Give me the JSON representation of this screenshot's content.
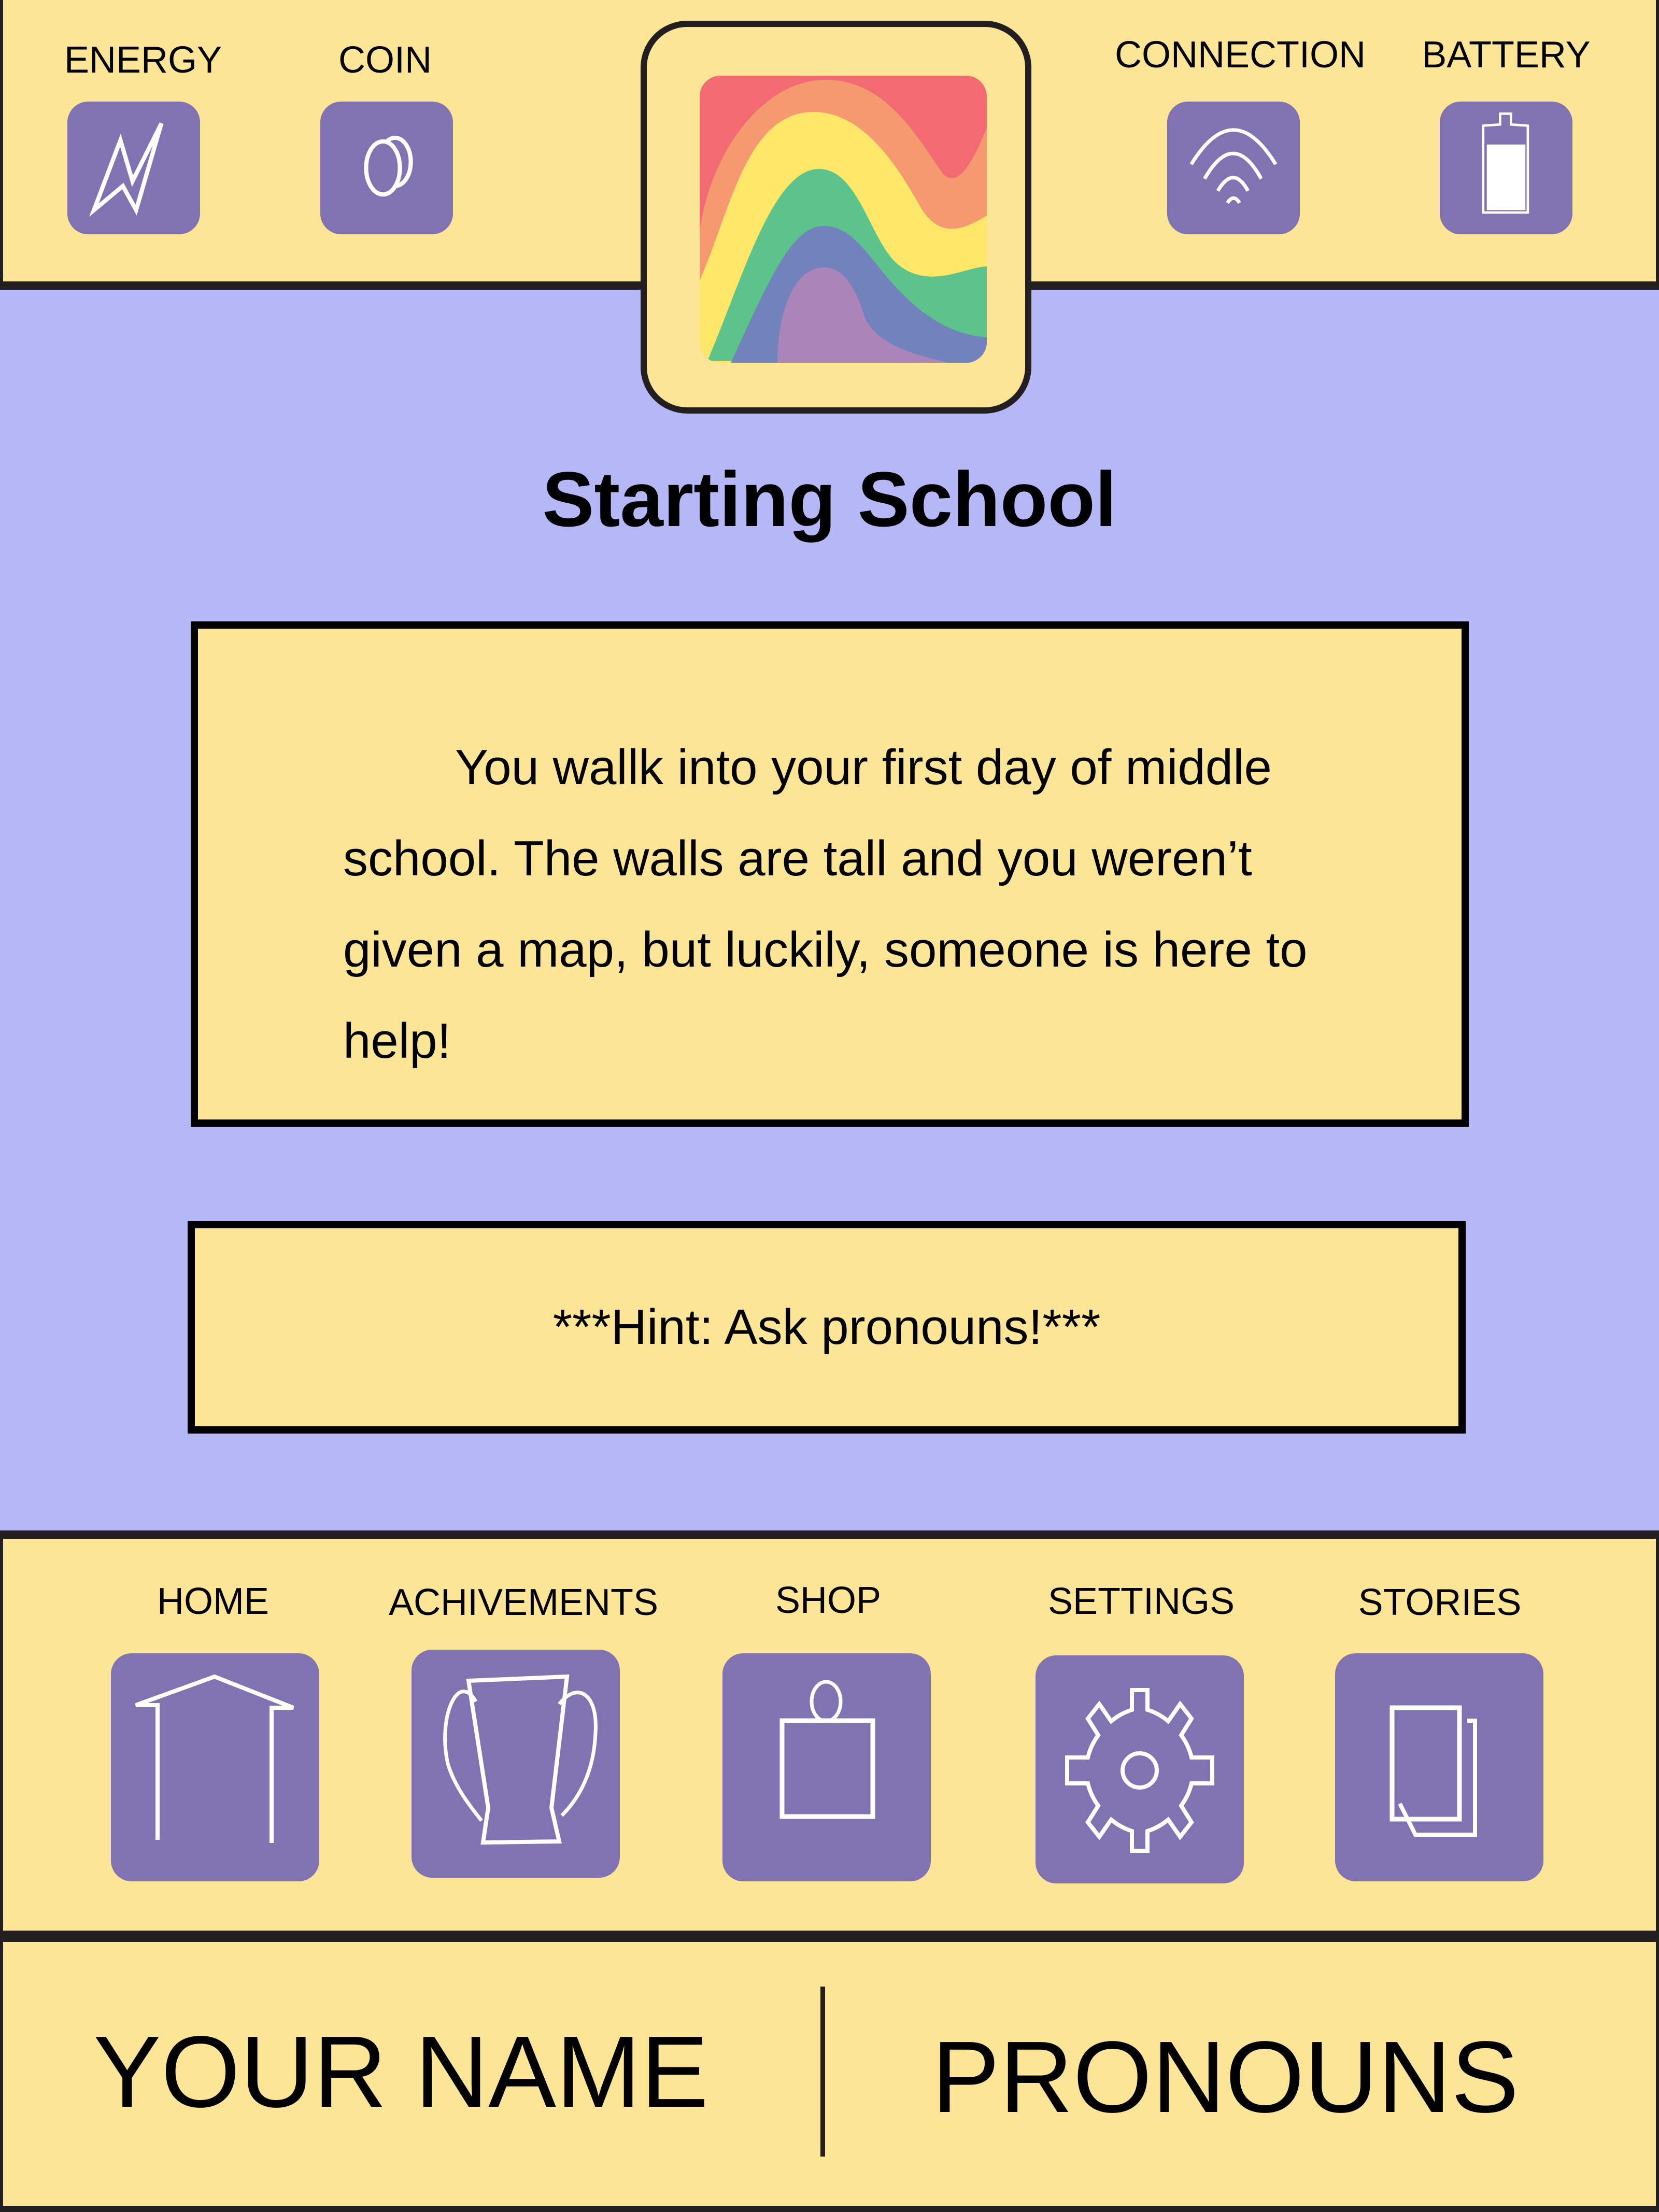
{
  "colors": {
    "panel": "#fce596",
    "background": "#b5b7f6",
    "tile": "#8173b1",
    "border": "#231f20",
    "rainbow": [
      "#f26b73",
      "#f59a70",
      "#ffe769",
      "#5bc38b",
      "#7282bd",
      "#ab84b9"
    ]
  },
  "status_bar": {
    "energy": {
      "label": "ENERGY",
      "icon": "lightning-bolt-icon"
    },
    "coin": {
      "label": "COIN",
      "icon": "coins-icon"
    },
    "connection": {
      "label": "CONNECTION",
      "icon": "wifi-icon"
    },
    "battery": {
      "label": "BATTERY",
      "icon": "battery-icon",
      "level_percent": 80
    }
  },
  "logo": {
    "icon": "rainbow-logo-icon"
  },
  "story": {
    "title": "Starting School",
    "text": "You wallk into your first day of middle school. The walls are tall and you weren’t given a map, but luckily, someone is here to help!",
    "hint": "***Hint: Ask pronouns!***"
  },
  "nav": {
    "items": [
      {
        "label": "HOME",
        "icon": "home-icon"
      },
      {
        "label": "ACHIVEMENTS",
        "icon": "trophy-icon"
      },
      {
        "label": "SHOP",
        "icon": "shopping-bag-icon"
      },
      {
        "label": "SETTINGS",
        "icon": "gear-icon"
      },
      {
        "label": "STORIES",
        "icon": "pages-icon"
      }
    ]
  },
  "profile": {
    "name": "YOUR NAME",
    "pronouns": "PRONOUNS"
  }
}
